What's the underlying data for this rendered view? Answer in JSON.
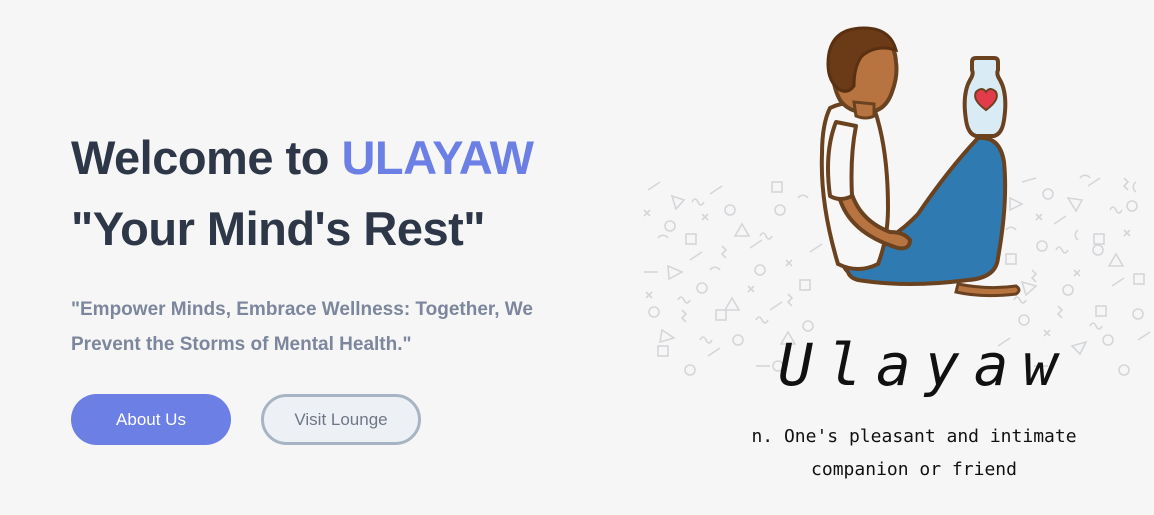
{
  "hero": {
    "title_prefix": "Welcome to ",
    "title_brand": "ULAYAW",
    "subtitle": "\"Your Mind's Rest\"",
    "tagline": "\"Empower Minds, Embrace Wellness: Together, We Prevent the Storms of Mental Health.\""
  },
  "buttons": {
    "about_label": "About Us",
    "lounge_label": "Visit Lounge"
  },
  "illustration": {
    "logo_word": "Ulayaw",
    "definition": "n. One's pleasant and intimate companion or friend"
  },
  "colors": {
    "brand": "#6b7fe5",
    "heading": "#2d3748",
    "tagline": "#7c869c",
    "background": "#f6f6f6"
  }
}
